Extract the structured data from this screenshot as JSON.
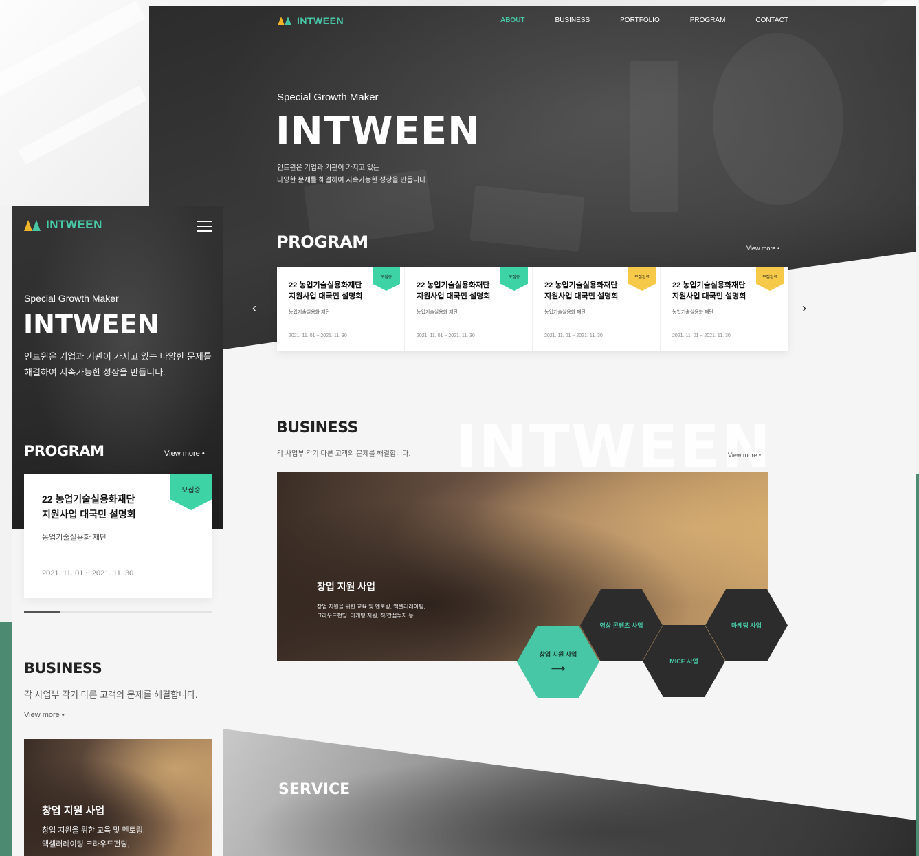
{
  "brand": {
    "logo_text": "INTWEEN",
    "accent": "#48c7a6",
    "tag_open_color": "#3dd3a4",
    "tag_closed_color": "#f7c948"
  },
  "nav": {
    "items": [
      "ABOUT",
      "BUSINESS",
      "PORTFOLIO",
      "PROGRAM",
      "CONTACT"
    ],
    "active": "ABOUT"
  },
  "hero": {
    "subtitle": "Special Growth Maker",
    "title": "INTWEEN",
    "desc_line1": "인트윈은 기업과 기관이 가지고 있는",
    "desc_line2": "다양한 문제를 해결하여 지속가능한 성장을 만듭니다."
  },
  "program": {
    "title": "PROGRAM",
    "view_more": "View more",
    "prev_icon": "chevron-left-icon",
    "next_icon": "chevron-right-icon",
    "cards": [
      {
        "tag": "모집중",
        "status": "open",
        "title_line1": "22 농업기술실용화재단",
        "title_line2": "지원사업 대국민 설명회",
        "org": "농업기술실용화 재단",
        "date": "2021. 11. 01 ~ 2021. 11. 30"
      },
      {
        "tag": "모집중",
        "status": "open",
        "title_line1": "22 농업기술실용화재단",
        "title_line2": "지원사업 대국민 설명회",
        "org": "농업기술실용화 재단",
        "date": "2021. 11. 01 ~ 2021. 11. 30"
      },
      {
        "tag": "모집완료",
        "status": "closed",
        "title_line1": "22 농업기술실용화재단",
        "title_line2": "지원사업 대국민 설명회",
        "org": "농업기술실용화 재단",
        "date": "2021. 11. 01 ~ 2021. 11. 30"
      },
      {
        "tag": "모집완료",
        "status": "closed",
        "title_line1": "22 농업기술실용화재단",
        "title_line2": "지원사업 대국민 설명회",
        "org": "농업기술실용화 재단",
        "date": "2021. 11. 01 ~ 2021. 11. 30"
      }
    ]
  },
  "business": {
    "title": "BUSINESS",
    "bg_text": "INTWEEN",
    "desc": "각 사업부 각기 다른 고객의 문제를 해결합니다.",
    "view_more": "View more",
    "feature_title": "창업 지원 사업",
    "feature_desc_line1": "창업 지원을 위한 교육 및 멘토링, 액셀러레이팅,",
    "feature_desc_line2": "크라우드펀딩, 마케팅 지원, 직/간접투자 등",
    "hexes": {
      "startup": "창업 지원 사업",
      "media": "영상 콘텐츠 사업",
      "mice": "MICE 사업",
      "marketing": "마케팅 사업",
      "arrow": "⟶"
    }
  },
  "service": {
    "title": "SERVICE"
  },
  "mobile": {
    "menu_icon": "hamburger-menu-icon",
    "hero": {
      "subtitle": "Special Growth Maker",
      "title": "INTWEEN",
      "desc": "인트윈은 기업과 기관이 가지고 있는 다양한 문제를 해결하여 지속가능한 성장을 만듭니다."
    },
    "program": {
      "title": "PROGRAM",
      "view_more": "View more",
      "card": {
        "tag": "모집중",
        "title_line1": "22 농업기술실용화재단",
        "title_line2": "지원사업 대국민 설명회",
        "org": "농업기술실용화 재단",
        "date": "2021. 11. 01 ~ 2021. 11. 30"
      },
      "progress": 0.19
    },
    "business": {
      "title": "BUSINESS",
      "desc": "각 사업부 각기 다른 고객의 문제를 해결합니다.",
      "view_more": "View more",
      "feature_title": "창업 지원 사업",
      "feature_desc_line1": "창업 지원을 위한 교육 및 멘토링,",
      "feature_desc_line2": "액셀러레이팅,크라우드펀딩,"
    }
  }
}
